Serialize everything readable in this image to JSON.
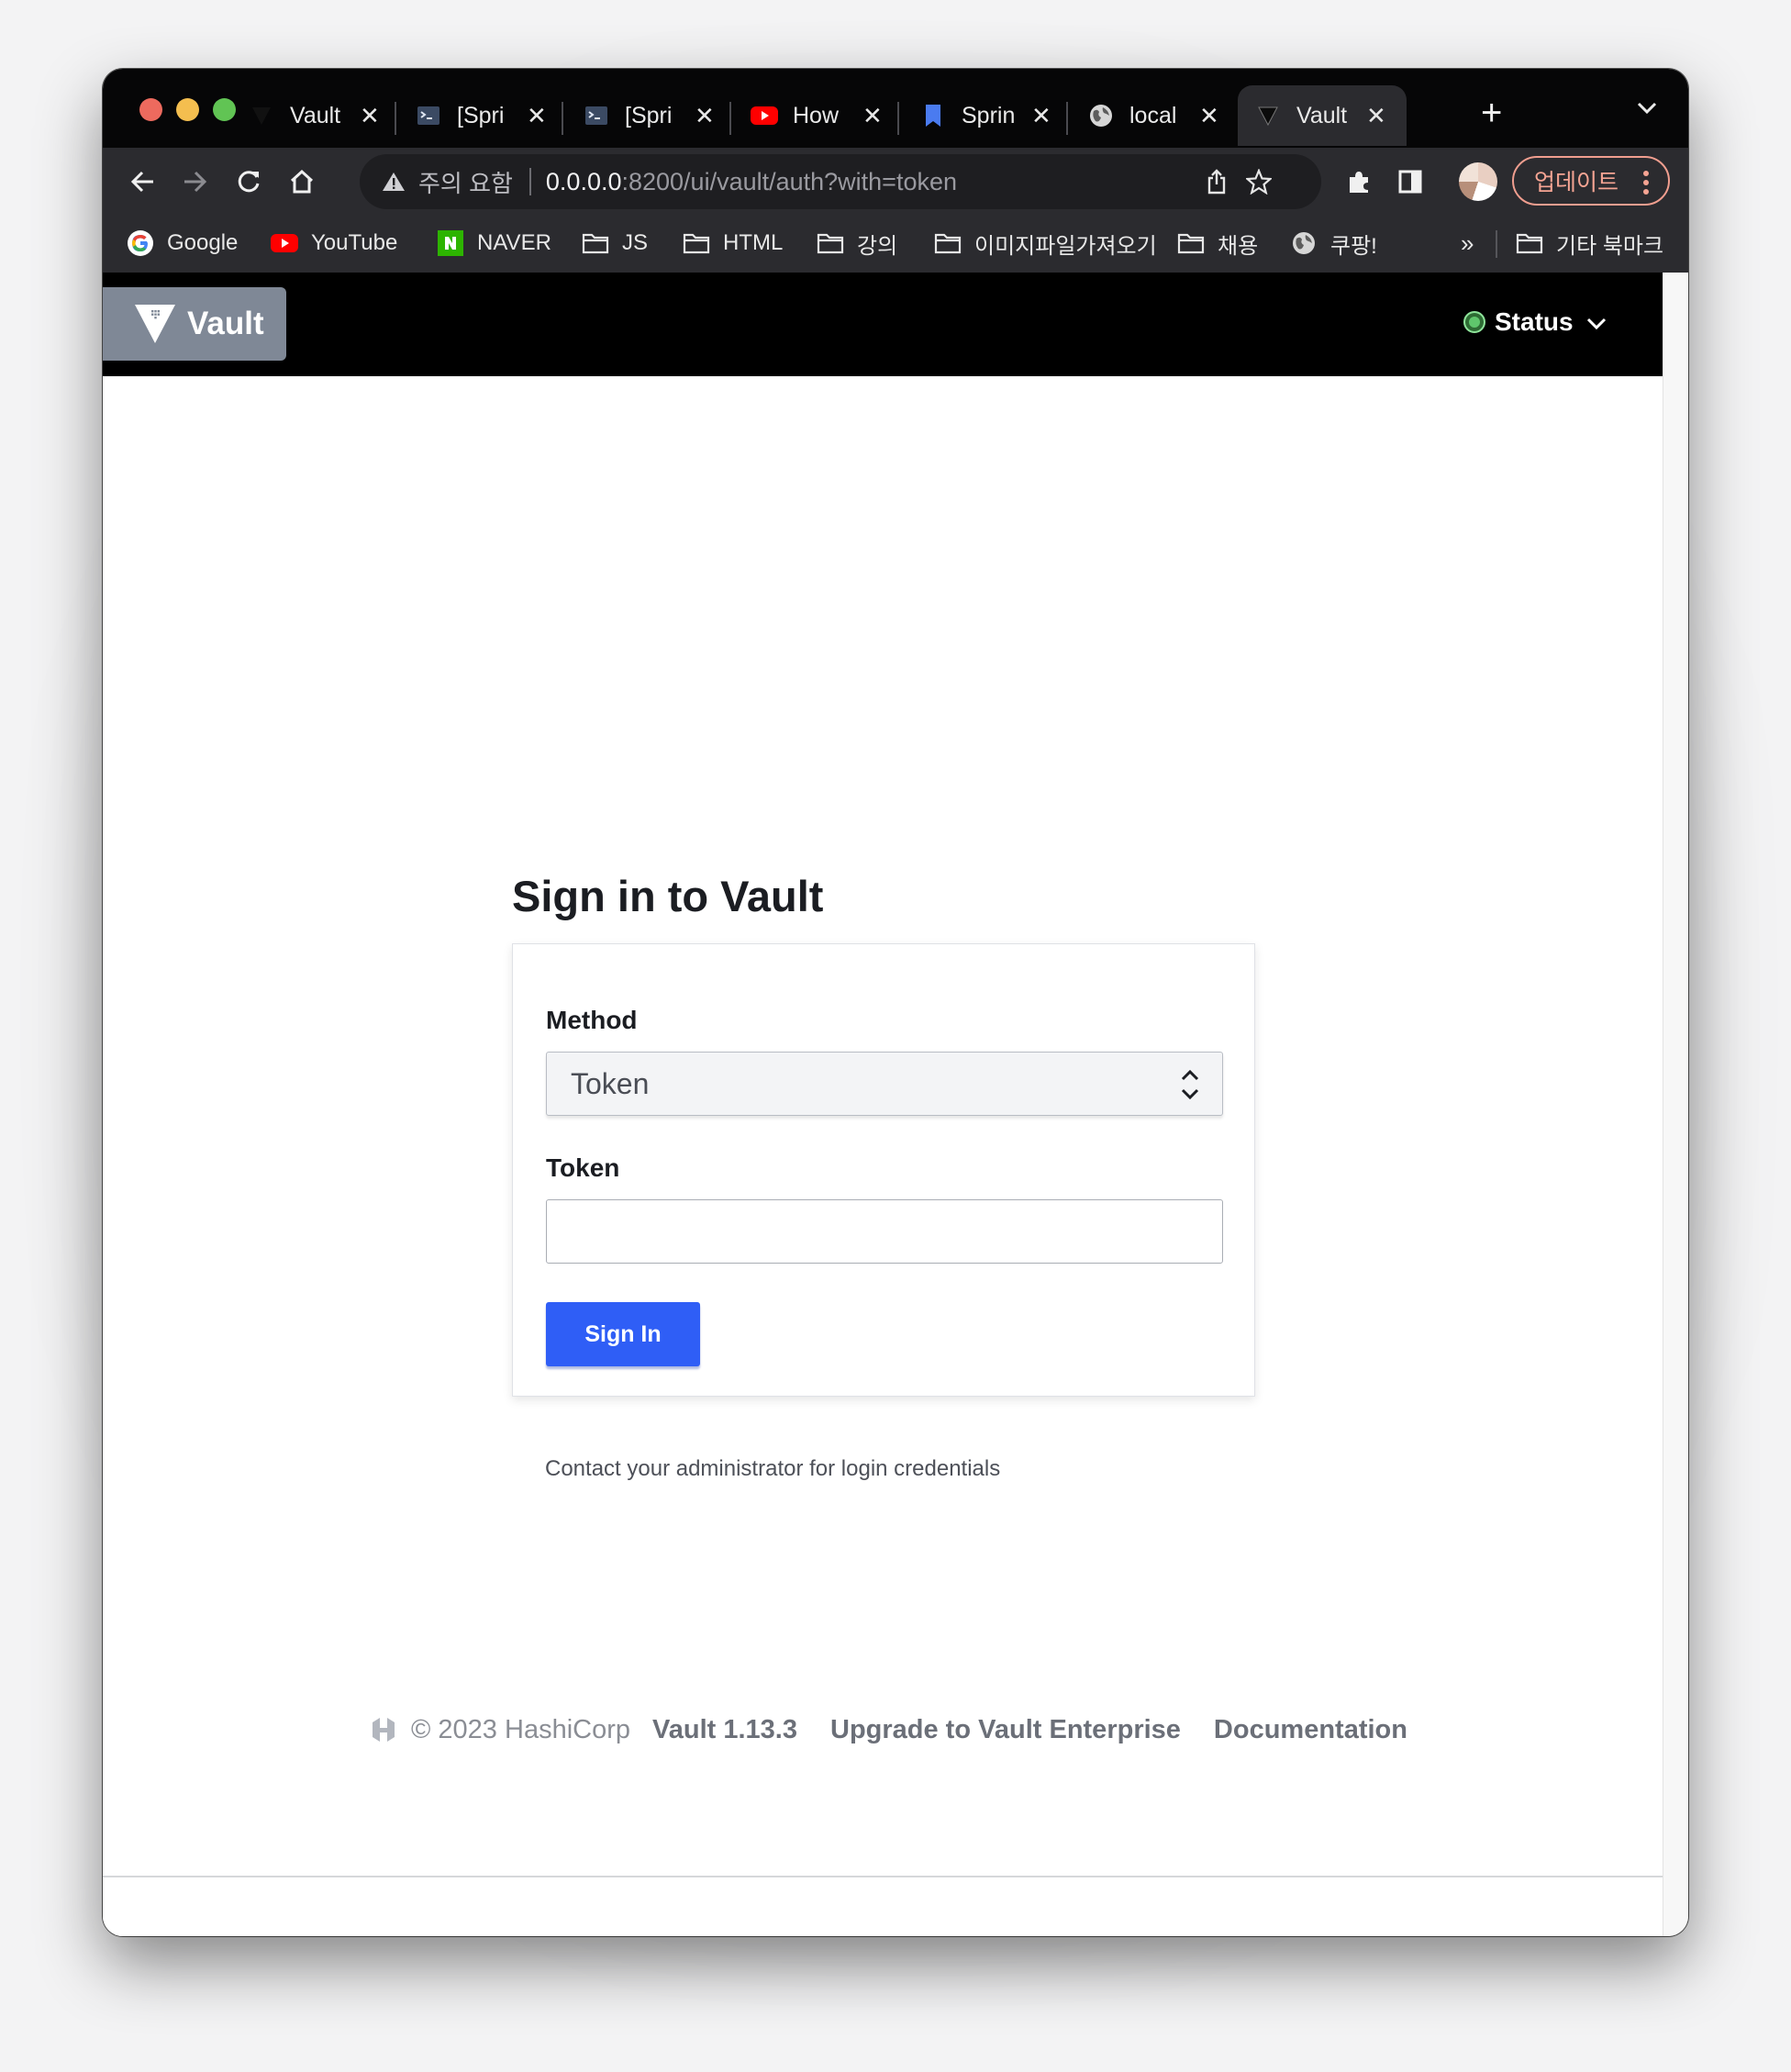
{
  "browser": {
    "tabs": [
      {
        "title": "Vault",
        "icon": "vault-icon"
      },
      {
        "title": "[Spri",
        "icon": "terminal-icon"
      },
      {
        "title": "[Spri",
        "icon": "terminal-icon"
      },
      {
        "title": "How",
        "icon": "youtube-icon"
      },
      {
        "title": "Sprin",
        "icon": "bookmark-icon"
      },
      {
        "title": "local",
        "icon": "globe-icon"
      },
      {
        "title": "Vault",
        "icon": "vault-icon",
        "active": true
      }
    ],
    "address": {
      "warning_text": "주의 요함",
      "host": "0.0.0.0",
      "rest": ":8200/ui/vault/auth?with=token"
    },
    "update_label": "업데이트",
    "bookmarks": [
      {
        "label": "Google",
        "icon": "google-icon"
      },
      {
        "label": "YouTube",
        "icon": "youtube-icon"
      },
      {
        "label": "NAVER",
        "icon": "naver-icon"
      },
      {
        "label": "JS",
        "icon": "folder-icon"
      },
      {
        "label": "HTML",
        "icon": "folder-icon"
      },
      {
        "label": "강의",
        "icon": "folder-icon"
      },
      {
        "label": "이미지파일가져오기",
        "icon": "folder-icon"
      },
      {
        "label": "채용",
        "icon": "folder-icon"
      },
      {
        "label": "쿠팡!",
        "icon": "globe-icon"
      }
    ],
    "bookmarks_more": "»",
    "other_bookmarks": "기타 북마크"
  },
  "vault": {
    "brand": "Vault",
    "status_label": "Status",
    "status_color": "#5fc66c",
    "title": "Sign in to Vault",
    "method_label": "Method",
    "method_value": "Token",
    "token_label": "Token",
    "token_value": "",
    "signin_label": "Sign In",
    "contact_text": "Contact your administrator for login credentials",
    "accent_color": "#2f5ef6"
  },
  "footer": {
    "copyright": "© 2023 HashiCorp",
    "version": "Vault 1.13.3",
    "upgrade": "Upgrade to Vault Enterprise",
    "docs": "Documentation"
  }
}
